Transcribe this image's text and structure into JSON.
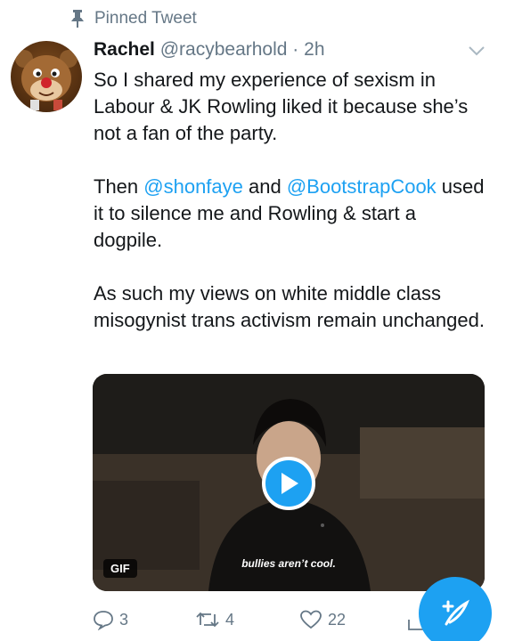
{
  "pinned": {
    "label": "Pinned Tweet"
  },
  "tweet": {
    "name": "Rachel",
    "handle": "@racybearhold",
    "separator": "·",
    "time": "2h",
    "paragraphs": [
      {
        "text": "So I shared my experience of sexism in Labour & JK Rowling liked it because she’s not a fan of the party."
      },
      {
        "pre": "Then ",
        "mention1": "@shonfaye",
        "mid": " and ",
        "mention2": "@BootstrapCook",
        "post": " used it to silence me and Rowling & start a dogpile."
      },
      {
        "text": "As such my views on white middle class misogynist trans activism remain unchanged."
      }
    ],
    "media": {
      "badge": "GIF",
      "subtitle": "bullies aren’t cool."
    },
    "actions": {
      "replies": "3",
      "retweets": "4",
      "likes": "22"
    }
  },
  "colors": {
    "accent": "#1da1f2",
    "secondary_text": "#657786",
    "text": "#14171a"
  },
  "icons": [
    "pin-icon",
    "chevron-down-icon",
    "play-icon",
    "reply-icon",
    "retweet-icon",
    "heart-icon",
    "share-icon",
    "compose-icon"
  ]
}
